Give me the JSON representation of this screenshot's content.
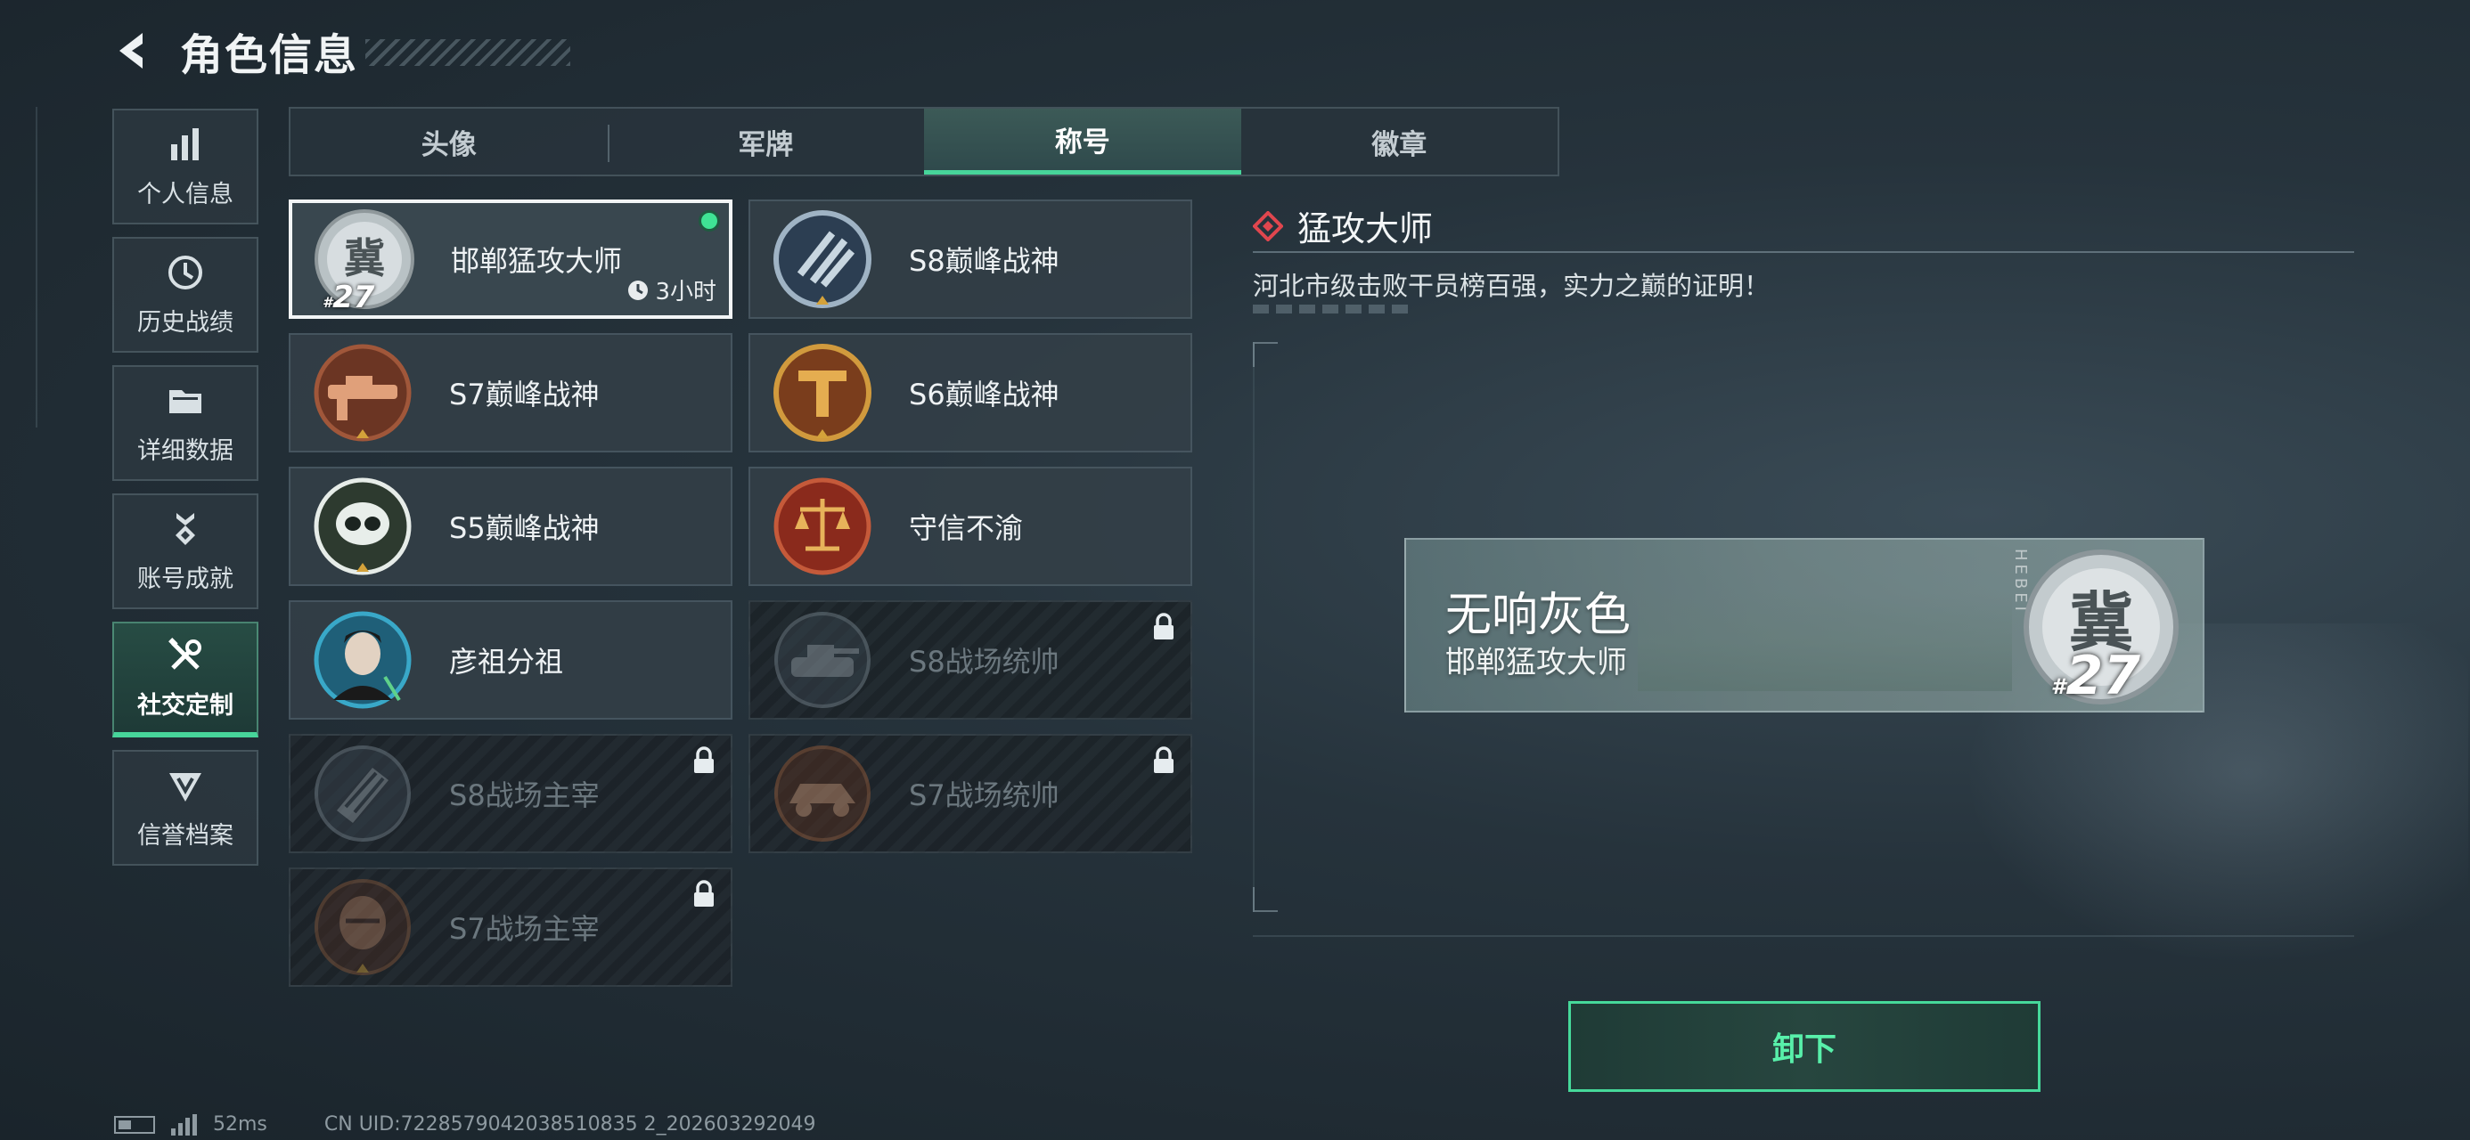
{
  "header": {
    "title": "角色信息"
  },
  "sidebar": {
    "items": [
      {
        "label": "个人信息",
        "icon": "bar-chart-icon"
      },
      {
        "label": "历史战绩",
        "icon": "history-clock-icon"
      },
      {
        "label": "详细数据",
        "icon": "folder-icon"
      },
      {
        "label": "账号成就",
        "icon": "achievement-medal-icon"
      },
      {
        "label": "社交定制",
        "icon": "wrench-screwdriver-icon",
        "active": true
      },
      {
        "label": "信誉档案",
        "icon": "credit-shield-icon"
      }
    ]
  },
  "tabs": [
    {
      "label": "头像"
    },
    {
      "label": "军牌"
    },
    {
      "label": "称号",
      "active": true
    },
    {
      "label": "徽章"
    }
  ],
  "titles": [
    {
      "name": "邯郸猛攻大师",
      "rank": "27",
      "timer": "3小时",
      "equipped": true,
      "locked": false
    },
    {
      "name": "S8巅峰战神",
      "locked": false
    },
    {
      "name": "S7巅峰战神",
      "locked": false
    },
    {
      "name": "S6巅峰战神",
      "locked": false
    },
    {
      "name": "S5巅峰战神",
      "locked": false
    },
    {
      "name": "守信不渝",
      "locked": false
    },
    {
      "name": "彦祖分祖",
      "locked": false
    },
    {
      "name": "S8战场统帅",
      "locked": true
    },
    {
      "name": "S8战场主宰",
      "locked": true
    },
    {
      "name": "S7战场统帅",
      "locked": true
    },
    {
      "name": "S7战场主宰",
      "locked": true
    }
  ],
  "detail": {
    "title": "猛攻大师",
    "description": "河北市级击败干员榜百强，实力之巅的证明！",
    "accent": "#e0464e"
  },
  "nameplate": {
    "player_name": "无响灰色",
    "title": "邯郸猛攻大师",
    "emblem_glyph": "冀",
    "rank": "27",
    "side_text": "HEBEI"
  },
  "actions": {
    "unequip_label": "卸下"
  },
  "status": {
    "ping": "52ms",
    "uid": "CN UID:7228579042038510835 2_202603292049"
  },
  "colors": {
    "accent_green": "#47d59a",
    "equipped_dot": "#3fe394"
  }
}
